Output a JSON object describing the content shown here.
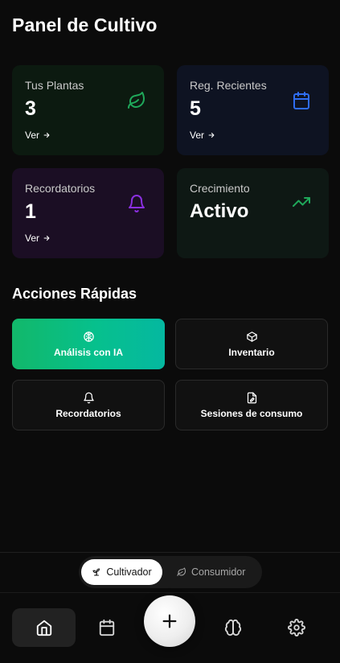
{
  "header": {
    "title": "Panel de Cultivo"
  },
  "stats": [
    {
      "label": "Tus Plantas",
      "value": "3",
      "link": "Ver",
      "icon": "leaf-icon",
      "color": "#1fa85a"
    },
    {
      "label": "Reg. Recientes",
      "value": "5",
      "link": "Ver",
      "icon": "calendar-icon",
      "color": "#2f6df2"
    },
    {
      "label": "Recordatorios",
      "value": "1",
      "link": "Ver",
      "icon": "bell-icon",
      "color": "#8b2fe0"
    },
    {
      "label": "Crecimiento",
      "value": "Activo",
      "icon": "trending-up-icon",
      "color": "#1fa85a"
    }
  ],
  "quick_actions": {
    "title": "Acciones Rápidas",
    "items": [
      {
        "label": "Análisis con IA",
        "icon": "brain-icon"
      },
      {
        "label": "Inventario",
        "icon": "box-icon"
      },
      {
        "label": "Recordatorios",
        "icon": "bell-icon"
      },
      {
        "label": "Sesiones de consumo",
        "icon": "file-edit-icon"
      }
    ]
  },
  "mode_toggle": {
    "active": "Cultivador",
    "options": [
      {
        "label": "Cultivador",
        "icon": "sprout-icon"
      },
      {
        "label": "Consumidor",
        "icon": "leaf-icon"
      }
    ]
  },
  "bottom_nav": {
    "items": [
      "home-icon",
      "calendar-icon",
      "plus-icon",
      "brain-icon",
      "gear-icon"
    ],
    "active": "home-icon"
  },
  "colors": {
    "background": "#0b0b0b",
    "accent_green": "#06c08d",
    "blue": "#2f6df2",
    "purple": "#8b2fe0"
  }
}
